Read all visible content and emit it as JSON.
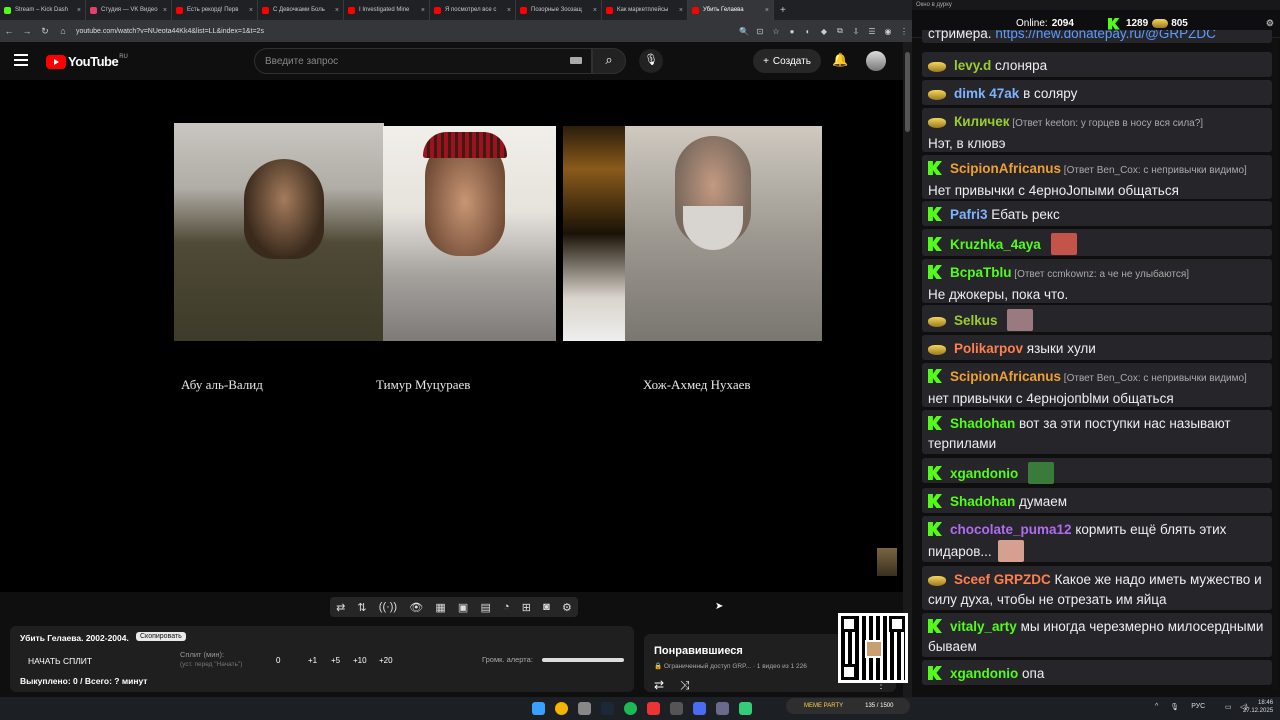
{
  "browser": {
    "tabs": [
      {
        "label": "Stream – Kick Dash",
        "color": "#53fc18"
      },
      {
        "label": "Студия — VK Видео",
        "color": "#e63e6d"
      },
      {
        "label": "Есть рекорд! Перв",
        "color": "#ff0000"
      },
      {
        "label": "С Девочками Боль",
        "color": "#ff0000"
      },
      {
        "label": "I Investigated Mine",
        "color": "#ff0000"
      },
      {
        "label": "Я посмотрел все с",
        "color": "#ff0000"
      },
      {
        "label": "Позорные Зоозащ",
        "color": "#ff0000"
      },
      {
        "label": "Как маркетплейсы",
        "color": "#ff0000"
      },
      {
        "label": "Убить Гелаева",
        "color": "#ff0000"
      }
    ],
    "url": "youtube.com/watch?v=NUeota44Kk4&list=LL&index=1&t=2s"
  },
  "youtube": {
    "logo_text": "YouTube",
    "region": "RU",
    "search_placeholder": "Введите запрос",
    "create_label": "Создать"
  },
  "video": {
    "captions": [
      "Абу аль-Валид",
      "Тимур Муцураев",
      "Хож-Ахмед  Нухаев"
    ]
  },
  "controls": {
    "icons": [
      "repeat-icon",
      "sort-icon",
      "broadcast-icon",
      "eye-icon",
      "clapper-icon",
      "frame-icon",
      "film-icon",
      "speed-icon",
      "add-clip-icon",
      "camera-icon",
      "settings-icon"
    ],
    "glyphs": [
      "⇄",
      "⇅",
      "((·))",
      "👁",
      "▦",
      "▣",
      "▤",
      "◔",
      "⊞",
      "◙",
      "⚙"
    ]
  },
  "split": {
    "title": "Убить Гелаева. 2002-2004.",
    "badge": "Скопировать",
    "start": "НАЧАТЬ СПЛИТ",
    "min_label": "Сплит (мин):",
    "min_hint": "(уст. перед \"Начать\")",
    "steps": [
      "0",
      "+1",
      "+5",
      "+10",
      "+20"
    ],
    "alert_label": "Громк. алерта:",
    "bought": "Выкуплено: 0 / Всего: ? минут"
  },
  "liked": {
    "title": "Понравившиеся",
    "subtitle": "🔒 Ограниченный доступ  GRP...  · 1 видео из 1 226"
  },
  "taskbar": {
    "meme_party": "MEME PARTY",
    "meme_count": "135 / 1500",
    "lang": "РУС",
    "time": "18:46",
    "date": "27.12.2025"
  },
  "chat": {
    "window_title": "Окно в дурку",
    "online_label": "Online:",
    "online_count": "2094",
    "count_a": "1289",
    "count_b": "805",
    "top_fragment": "стримера.",
    "top_link": "https://new.donatepay.ru/@GRPZDC",
    "messages": [
      {
        "user": "levy.d",
        "color": "#9acd32",
        "badge": "m",
        "text": "слоняра"
      },
      {
        "user": "dimk 47ak",
        "color": "#7fb3ff",
        "badge": "m",
        "text": "в соляру"
      },
      {
        "user": "Киличек",
        "color": "#9acd32",
        "badge": "m",
        "reply": "[Ответ keeton: у горцев в носу вся сила?]",
        "text": "Нэт, в клювэ"
      },
      {
        "user": "ScipionAfricanus",
        "color": "#f0a030",
        "badge": "k",
        "reply": "[Ответ Ben_Cox: с непривычки видимо]",
        "text": "Нет привычки с 4ерноJопыми общаться"
      },
      {
        "user": "Pafri3",
        "color": "#7fb3ff",
        "badge": "k",
        "text": "Ебать рекс"
      },
      {
        "user": "Kruzhka_4aya",
        "color": "#53fc18",
        "badge": "k",
        "text": ""
      },
      {
        "user": "BcpaTblu",
        "color": "#53fc18",
        "badge": "k",
        "reply": "[Ответ ccmkownz: а че не улыбаются]",
        "text": "Не джокеры, пока что."
      },
      {
        "user": "Selkus",
        "color": "#9acd32",
        "badge": "m",
        "text": ""
      },
      {
        "user": "Polikarpov",
        "color": "#ff7f50",
        "badge": "m",
        "text": "языки хули"
      },
      {
        "user": "ScipionAfricanus",
        "color": "#f0a030",
        "badge": "k",
        "reply": "[Ответ Ben_Cox: с непривычки видимо]",
        "text": "нет привычки с 4ерноjопblми общаться"
      },
      {
        "user": "Shadohan",
        "color": "#53fc18",
        "badge": "k",
        "text": "вот за эти поступки нас называют терпилами"
      },
      {
        "user": "xgandonio",
        "color": "#53fc18",
        "badge": "k",
        "text": ""
      },
      {
        "user": "Shadohan",
        "color": "#53fc18",
        "badge": "k",
        "text": "думаем"
      },
      {
        "user": "chocolate_puma12",
        "color": "#b06cf0",
        "badge": "k",
        "text": "кормить ещё блять этих пидаров..."
      },
      {
        "user": "Sceef",
        "user2": "GRPZDC",
        "color": "#ff7f50",
        "badge": "m",
        "text": "Какое же надо иметь мужество и силу духа, чтобы не отрезать им яйца"
      },
      {
        "user": "vitaly_arty",
        "color": "#53fc18",
        "badge": "k",
        "text": "мы иногда черезмерно милосердными бываем"
      },
      {
        "user": "xgandonio",
        "color": "#53fc18",
        "badge": "k",
        "text": "опа"
      }
    ]
  }
}
